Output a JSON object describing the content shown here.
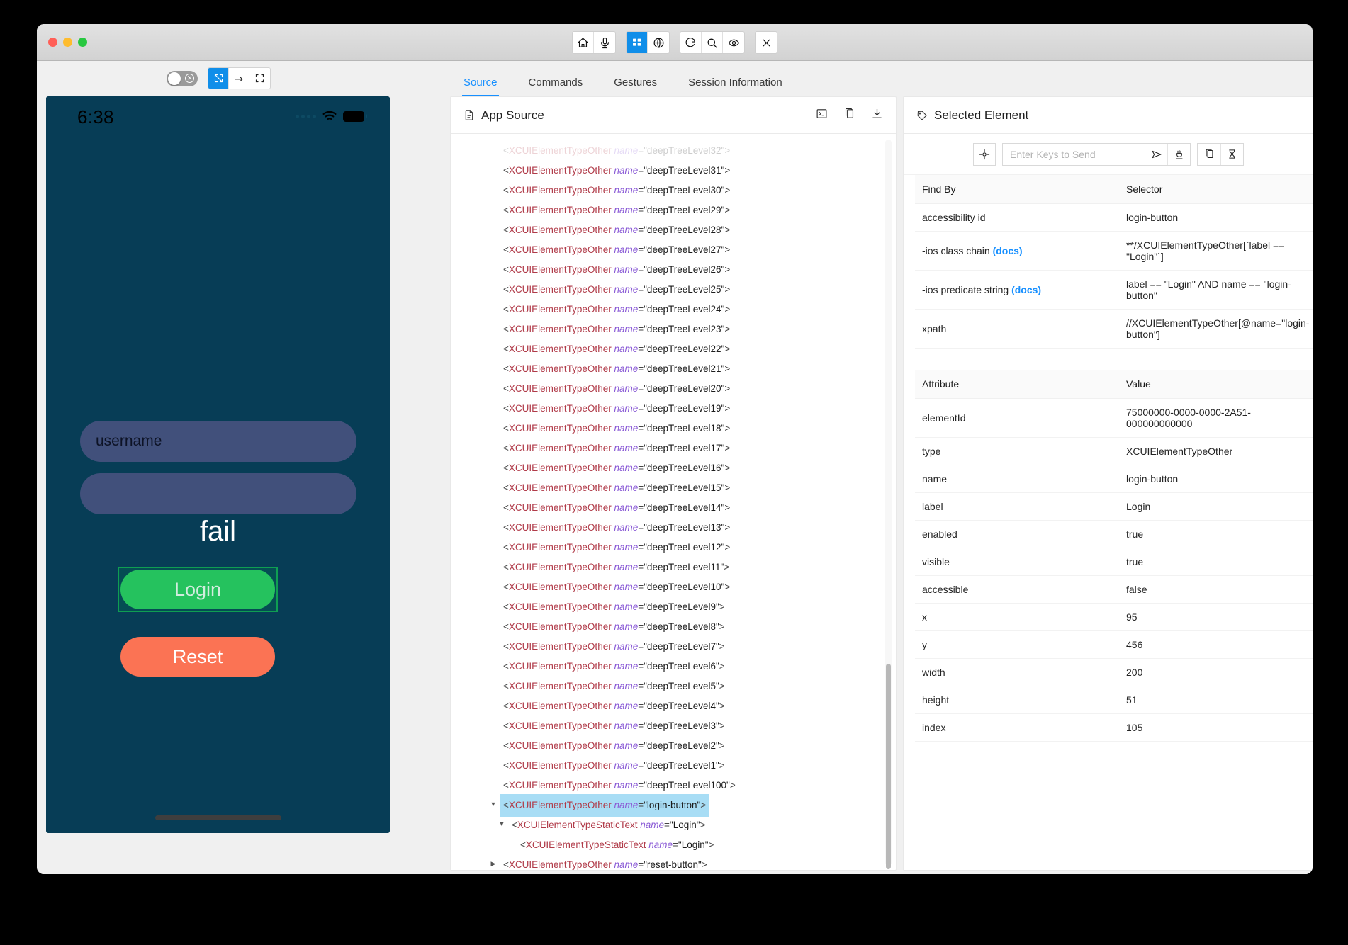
{
  "window": {
    "traffic_lights": [
      "close",
      "minimize",
      "zoom"
    ],
    "toolbar_groups": [
      {
        "buttons": [
          {
            "name": "home-button",
            "icon": "home-icon",
            "active": false
          },
          {
            "name": "record-button",
            "icon": "microphone-icon",
            "active": false
          }
        ]
      },
      {
        "buttons": [
          {
            "name": "app-source-button",
            "icon": "layout-grid-icon",
            "active": true
          },
          {
            "name": "web-context-button",
            "icon": "globe-icon",
            "active": false
          }
        ]
      },
      {
        "buttons": [
          {
            "name": "refresh-button",
            "icon": "refresh-icon",
            "active": false
          },
          {
            "name": "search-button",
            "icon": "magnifier-icon",
            "active": false
          },
          {
            "name": "inspect-button",
            "icon": "eye-icon",
            "active": false
          }
        ]
      },
      {
        "buttons": [
          {
            "name": "quit-session-button",
            "icon": "x-icon",
            "active": false
          }
        ]
      }
    ]
  },
  "subbar": {
    "toggle": {
      "label": "screenshot-toggle",
      "on": false
    },
    "segments": [
      {
        "name": "select-mode-button",
        "icon": "cursor-select-icon",
        "active": true
      },
      {
        "name": "swipe-mode-button",
        "icon": "swipe-arrow-icon",
        "active": false
      },
      {
        "name": "tap-mode-button",
        "icon": "crop-frame-icon",
        "active": false
      }
    ],
    "tabs": [
      {
        "label": "Source",
        "active": true
      },
      {
        "label": "Commands",
        "active": false
      },
      {
        "label": "Gestures",
        "active": false
      },
      {
        "label": "Session Information",
        "active": false
      }
    ]
  },
  "device": {
    "status_bar": {
      "time": "6:38"
    },
    "username_field": {
      "value": "username",
      "placeholder": "username"
    },
    "password_field": {
      "value": "",
      "placeholder": ""
    },
    "message": "fail",
    "login_button": "Login",
    "reset_button": "Reset"
  },
  "source_panel": {
    "title": "App Source",
    "actions": [
      {
        "name": "open-in-terminal-icon"
      },
      {
        "name": "copy-xml-icon"
      },
      {
        "name": "download-xml-icon"
      }
    ],
    "tree": [
      {
        "indent": 5,
        "twisty": "",
        "tag": "XCUIElementTypeOther",
        "attr": "name",
        "value": "deepTreeLevel32",
        "faded": true,
        "selected": false
      },
      {
        "indent": 5,
        "twisty": "",
        "tag": "XCUIElementTypeOther",
        "attr": "name",
        "value": "deepTreeLevel31",
        "faded": false,
        "selected": false
      },
      {
        "indent": 5,
        "twisty": "",
        "tag": "XCUIElementTypeOther",
        "attr": "name",
        "value": "deepTreeLevel30",
        "faded": false,
        "selected": false
      },
      {
        "indent": 5,
        "twisty": "",
        "tag": "XCUIElementTypeOther",
        "attr": "name",
        "value": "deepTreeLevel29",
        "faded": false,
        "selected": false
      },
      {
        "indent": 5,
        "twisty": "",
        "tag": "XCUIElementTypeOther",
        "attr": "name",
        "value": "deepTreeLevel28",
        "faded": false,
        "selected": false
      },
      {
        "indent": 5,
        "twisty": "",
        "tag": "XCUIElementTypeOther",
        "attr": "name",
        "value": "deepTreeLevel27",
        "faded": false,
        "selected": false
      },
      {
        "indent": 5,
        "twisty": "",
        "tag": "XCUIElementTypeOther",
        "attr": "name",
        "value": "deepTreeLevel26",
        "faded": false,
        "selected": false
      },
      {
        "indent": 5,
        "twisty": "",
        "tag": "XCUIElementTypeOther",
        "attr": "name",
        "value": "deepTreeLevel25",
        "faded": false,
        "selected": false
      },
      {
        "indent": 5,
        "twisty": "",
        "tag": "XCUIElementTypeOther",
        "attr": "name",
        "value": "deepTreeLevel24",
        "faded": false,
        "selected": false
      },
      {
        "indent": 5,
        "twisty": "",
        "tag": "XCUIElementTypeOther",
        "attr": "name",
        "value": "deepTreeLevel23",
        "faded": false,
        "selected": false
      },
      {
        "indent": 5,
        "twisty": "",
        "tag": "XCUIElementTypeOther",
        "attr": "name",
        "value": "deepTreeLevel22",
        "faded": false,
        "selected": false
      },
      {
        "indent": 5,
        "twisty": "",
        "tag": "XCUIElementTypeOther",
        "attr": "name",
        "value": "deepTreeLevel21",
        "faded": false,
        "selected": false
      },
      {
        "indent": 5,
        "twisty": "",
        "tag": "XCUIElementTypeOther",
        "attr": "name",
        "value": "deepTreeLevel20",
        "faded": false,
        "selected": false
      },
      {
        "indent": 5,
        "twisty": "",
        "tag": "XCUIElementTypeOther",
        "attr": "name",
        "value": "deepTreeLevel19",
        "faded": false,
        "selected": false
      },
      {
        "indent": 5,
        "twisty": "",
        "tag": "XCUIElementTypeOther",
        "attr": "name",
        "value": "deepTreeLevel18",
        "faded": false,
        "selected": false
      },
      {
        "indent": 5,
        "twisty": "",
        "tag": "XCUIElementTypeOther",
        "attr": "name",
        "value": "deepTreeLevel17",
        "faded": false,
        "selected": false
      },
      {
        "indent": 5,
        "twisty": "",
        "tag": "XCUIElementTypeOther",
        "attr": "name",
        "value": "deepTreeLevel16",
        "faded": false,
        "selected": false
      },
      {
        "indent": 5,
        "twisty": "",
        "tag": "XCUIElementTypeOther",
        "attr": "name",
        "value": "deepTreeLevel15",
        "faded": false,
        "selected": false
      },
      {
        "indent": 5,
        "twisty": "",
        "tag": "XCUIElementTypeOther",
        "attr": "name",
        "value": "deepTreeLevel14",
        "faded": false,
        "selected": false
      },
      {
        "indent": 5,
        "twisty": "",
        "tag": "XCUIElementTypeOther",
        "attr": "name",
        "value": "deepTreeLevel13",
        "faded": false,
        "selected": false
      },
      {
        "indent": 5,
        "twisty": "",
        "tag": "XCUIElementTypeOther",
        "attr": "name",
        "value": "deepTreeLevel12",
        "faded": false,
        "selected": false
      },
      {
        "indent": 5,
        "twisty": "",
        "tag": "XCUIElementTypeOther",
        "attr": "name",
        "value": "deepTreeLevel11",
        "faded": false,
        "selected": false
      },
      {
        "indent": 5,
        "twisty": "",
        "tag": "XCUIElementTypeOther",
        "attr": "name",
        "value": "deepTreeLevel10",
        "faded": false,
        "selected": false
      },
      {
        "indent": 5,
        "twisty": "",
        "tag": "XCUIElementTypeOther",
        "attr": "name",
        "value": "deepTreeLevel9",
        "faded": false,
        "selected": false
      },
      {
        "indent": 5,
        "twisty": "",
        "tag": "XCUIElementTypeOther",
        "attr": "name",
        "value": "deepTreeLevel8",
        "faded": false,
        "selected": false
      },
      {
        "indent": 5,
        "twisty": "",
        "tag": "XCUIElementTypeOther",
        "attr": "name",
        "value": "deepTreeLevel7",
        "faded": false,
        "selected": false
      },
      {
        "indent": 5,
        "twisty": "",
        "tag": "XCUIElementTypeOther",
        "attr": "name",
        "value": "deepTreeLevel6",
        "faded": false,
        "selected": false
      },
      {
        "indent": 5,
        "twisty": "",
        "tag": "XCUIElementTypeOther",
        "attr": "name",
        "value": "deepTreeLevel5",
        "faded": false,
        "selected": false
      },
      {
        "indent": 5,
        "twisty": "",
        "tag": "XCUIElementTypeOther",
        "attr": "name",
        "value": "deepTreeLevel4",
        "faded": false,
        "selected": false
      },
      {
        "indent": 5,
        "twisty": "",
        "tag": "XCUIElementTypeOther",
        "attr": "name",
        "value": "deepTreeLevel3",
        "faded": false,
        "selected": false
      },
      {
        "indent": 5,
        "twisty": "",
        "tag": "XCUIElementTypeOther",
        "attr": "name",
        "value": "deepTreeLevel2",
        "faded": false,
        "selected": false
      },
      {
        "indent": 5,
        "twisty": "",
        "tag": "XCUIElementTypeOther",
        "attr": "name",
        "value": "deepTreeLevel1",
        "faded": false,
        "selected": false
      },
      {
        "indent": 5,
        "twisty": "",
        "tag": "XCUIElementTypeOther",
        "attr": "name",
        "value": "deepTreeLevel100",
        "faded": false,
        "selected": false
      },
      {
        "indent": 5,
        "twisty": "down",
        "tag": "XCUIElementTypeOther",
        "attr": "name",
        "value": "login-button",
        "faded": false,
        "selected": true
      },
      {
        "indent": 6,
        "twisty": "down",
        "tag": "XCUIElementTypeStaticText",
        "attr": "name",
        "value": "Login",
        "faded": false,
        "selected": false
      },
      {
        "indent": 7,
        "twisty": "",
        "tag": "XCUIElementTypeStaticText",
        "attr": "name",
        "value": "Login",
        "faded": false,
        "selected": false
      },
      {
        "indent": 5,
        "twisty": "right",
        "tag": "XCUIElementTypeOther",
        "attr": "name",
        "value": "reset-button",
        "faded": false,
        "selected": false
      }
    ]
  },
  "selected_panel": {
    "title": "Selected Element",
    "toolbar": {
      "tap_button": "tap-target-icon",
      "keys_placeholder": "Enter Keys to Send",
      "keys_value": "",
      "send_keys_button": "send-icon",
      "clear_button": "clear-brush-icon",
      "copy_button": "copy-icon",
      "timer_button": "hourglass-icon"
    },
    "selector_table": {
      "headers": [
        "Find By",
        "Selector"
      ],
      "rows": [
        {
          "find_by": "accessibility id",
          "docs": false,
          "selector": "login-button"
        },
        {
          "find_by": "-ios class chain",
          "docs": true,
          "selector": "**/XCUIElementTypeOther[`label == \"Login\"`]"
        },
        {
          "find_by": "-ios predicate string",
          "docs": true,
          "selector": "label == \"Login\" AND name == \"login-button\""
        },
        {
          "find_by": "xpath",
          "docs": false,
          "selector": "//XCUIElementTypeOther[@name=\"login-button\"]"
        }
      ]
    },
    "attribute_table": {
      "headers": [
        "Attribute",
        "Value"
      ],
      "rows": [
        {
          "attribute": "elementId",
          "value": "75000000-0000-0000-2A51-000000000000"
        },
        {
          "attribute": "type",
          "value": "XCUIElementTypeOther"
        },
        {
          "attribute": "name",
          "value": "login-button"
        },
        {
          "attribute": "label",
          "value": "Login"
        },
        {
          "attribute": "enabled",
          "value": "true"
        },
        {
          "attribute": "visible",
          "value": "true"
        },
        {
          "attribute": "accessible",
          "value": "false"
        },
        {
          "attribute": "x",
          "value": "95"
        },
        {
          "attribute": "y",
          "value": "456"
        },
        {
          "attribute": "width",
          "value": "200"
        },
        {
          "attribute": "height",
          "value": "51"
        },
        {
          "attribute": "index",
          "value": "105"
        }
      ]
    }
  },
  "colors": {
    "accent": "#1890ff",
    "active_blue": "#108ee9",
    "device_bg": "#073d56",
    "field_bg": "#41507b",
    "login_green": "#2ecc63",
    "reset_orange": "#fb7354",
    "selection_highlight": "#a8ddf5"
  }
}
